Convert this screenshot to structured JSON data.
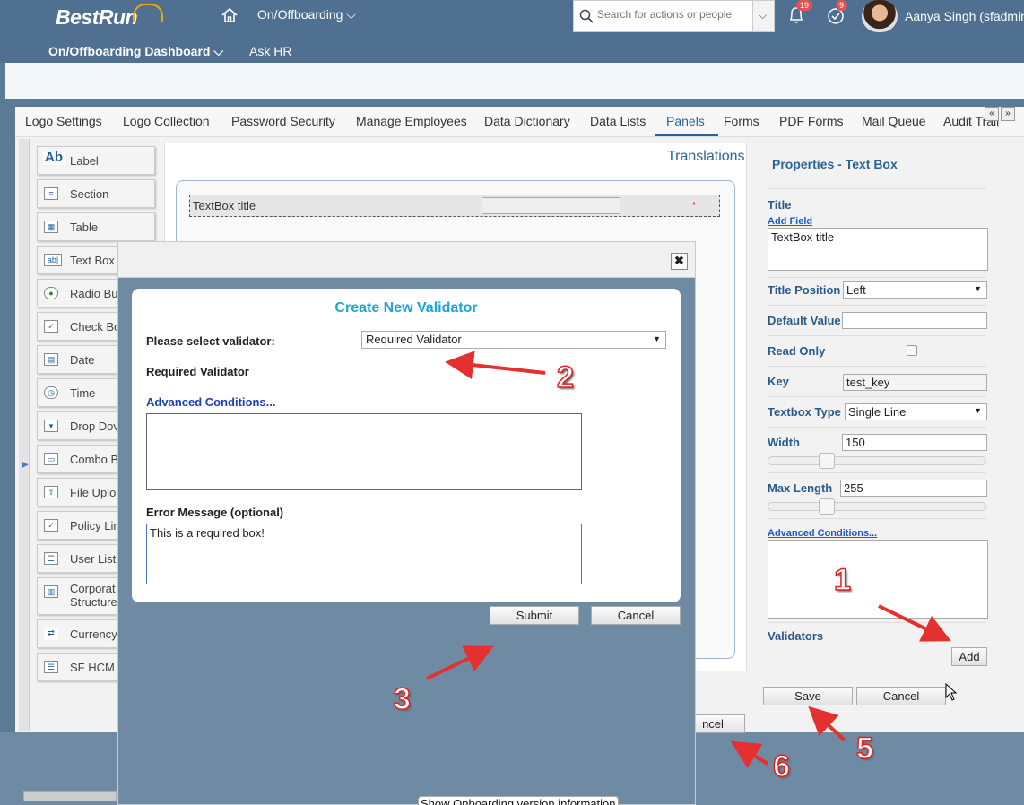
{
  "shell": {
    "logo": "BestRun",
    "module": "On/Offboarding",
    "search_placeholder": "Search for actions or people",
    "notifications_count": "19",
    "tasks_count": "9",
    "user": "Aanya Singh (sfadmin",
    "dashboard_menu": "On/Offboarding Dashboard",
    "ask_hr": "Ask HR"
  },
  "tabs": [
    {
      "label": "Logo Settings"
    },
    {
      "label": "Logo Collection"
    },
    {
      "label": "Password Security"
    },
    {
      "label": "Manage Employees"
    },
    {
      "label": "Data Dictionary"
    },
    {
      "label": "Data Lists"
    },
    {
      "label": "Panels"
    },
    {
      "label": "Forms"
    },
    {
      "label": "PDF Forms"
    },
    {
      "label": "Mail Queue"
    },
    {
      "label": "Audit Trail"
    }
  ],
  "palette": [
    {
      "label": "Label",
      "icon": "label-icon"
    },
    {
      "label": "Section",
      "icon": "section-icon"
    },
    {
      "label": "Table",
      "icon": "table-icon"
    },
    {
      "label": "Text Box",
      "icon": "textbox-icon"
    },
    {
      "label": "Radio Bu",
      "icon": "radio-icon"
    },
    {
      "label": "Check Bo",
      "icon": "checkbox-icon"
    },
    {
      "label": "Date",
      "icon": "calendar-icon"
    },
    {
      "label": "Time",
      "icon": "clock-icon"
    },
    {
      "label": "Drop Dov",
      "icon": "dropdown-icon"
    },
    {
      "label": "Combo B",
      "icon": "combobox-icon"
    },
    {
      "label": "File Uplo",
      "icon": "upload-icon"
    },
    {
      "label": "Policy Lir",
      "icon": "policy-icon"
    },
    {
      "label": "User List",
      "icon": "userlist-icon"
    },
    {
      "label": "Corporat",
      "label2": "Structure",
      "icon": "corporate-icon"
    },
    {
      "label": "Currency",
      "icon": "currency-icon"
    },
    {
      "label": "SF HCM",
      "icon": "sfhcm-icon"
    }
  ],
  "canvas": {
    "translations": "Translations",
    "textbox_title": "TextBox title",
    "required_marker": "*",
    "cancel_behind": "ncel"
  },
  "properties": {
    "title": "Properties - Text Box",
    "title_label": "Title",
    "add_field": "Add Field",
    "title_value": "TextBox title",
    "title_position_label": "Title Position",
    "title_position_value": "Left",
    "default_value_label": "Default Value",
    "default_value": "",
    "read_only_label": "Read Only",
    "key_label": "Key",
    "key_value": "test_key",
    "textbox_type_label": "Textbox Type",
    "textbox_type_value": "Single Line",
    "width_label": "Width",
    "width_value": "150",
    "max_length_label": "Max Length",
    "max_length_value": "255",
    "advanced_conditions": "Advanced Conditions...",
    "validators_label": "Validators",
    "add_button": "Add",
    "save_button": "Save",
    "cancel_button": "Cancel"
  },
  "dialog": {
    "title": "Create New Validator",
    "select_label": "Please select validator:",
    "select_value": "Required Validator",
    "validator_name": "Required Validator",
    "advanced_conditions": "Advanced Conditions...",
    "error_label": "Error Message (optional)",
    "error_value": "This is a required box!",
    "submit": "Submit",
    "cancel": "Cancel",
    "close": "✖"
  },
  "version_info": "Show Onboarding version information",
  "annotations": [
    "1",
    "2",
    "3",
    "5",
    "6"
  ]
}
